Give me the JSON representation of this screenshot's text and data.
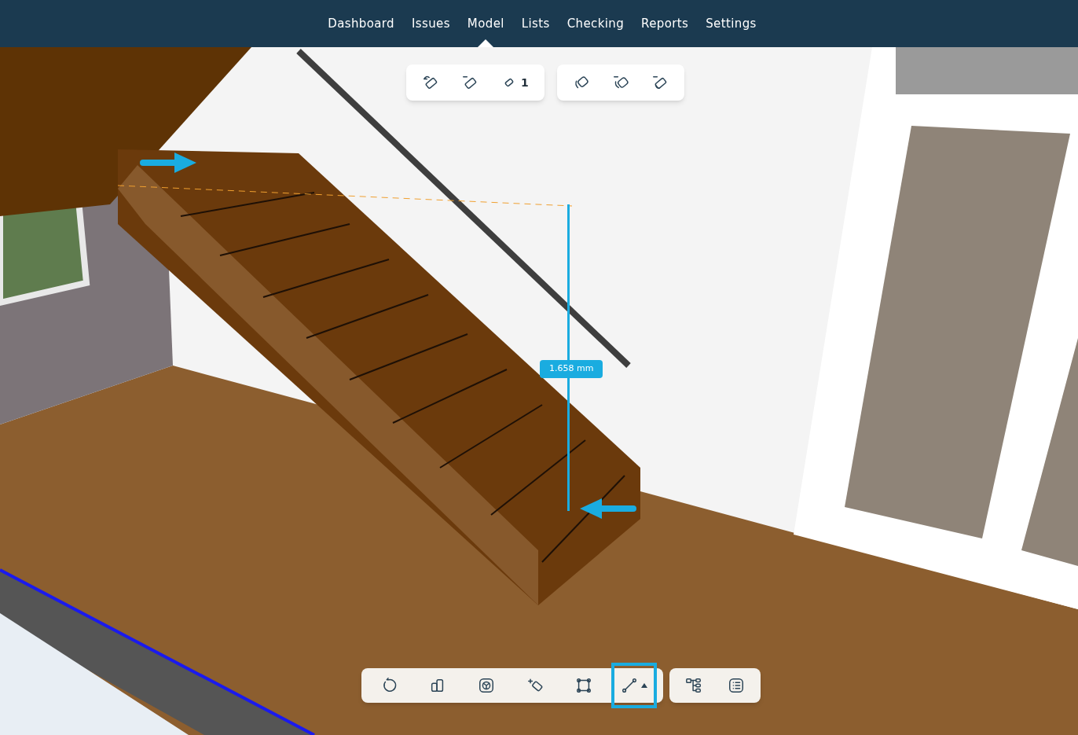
{
  "nav": {
    "tabs": [
      {
        "label": "Dashboard",
        "selected": false
      },
      {
        "label": "Issues",
        "selected": false
      },
      {
        "label": "Model",
        "selected": true
      },
      {
        "label": "Lists",
        "selected": false
      },
      {
        "label": "Checking",
        "selected": false
      },
      {
        "label": "Reports",
        "selected": false
      },
      {
        "label": "Settings",
        "selected": false
      }
    ]
  },
  "measure_toolbar": {
    "measurement_count": "1"
  },
  "measurement": {
    "label": "1.658 mm"
  },
  "bottom_toolbar": {
    "tools": [
      {
        "selected": false
      },
      {
        "selected": false
      },
      {
        "selected": false
      },
      {
        "selected": false
      },
      {
        "selected": false
      },
      {
        "selected": true
      }
    ]
  }
}
